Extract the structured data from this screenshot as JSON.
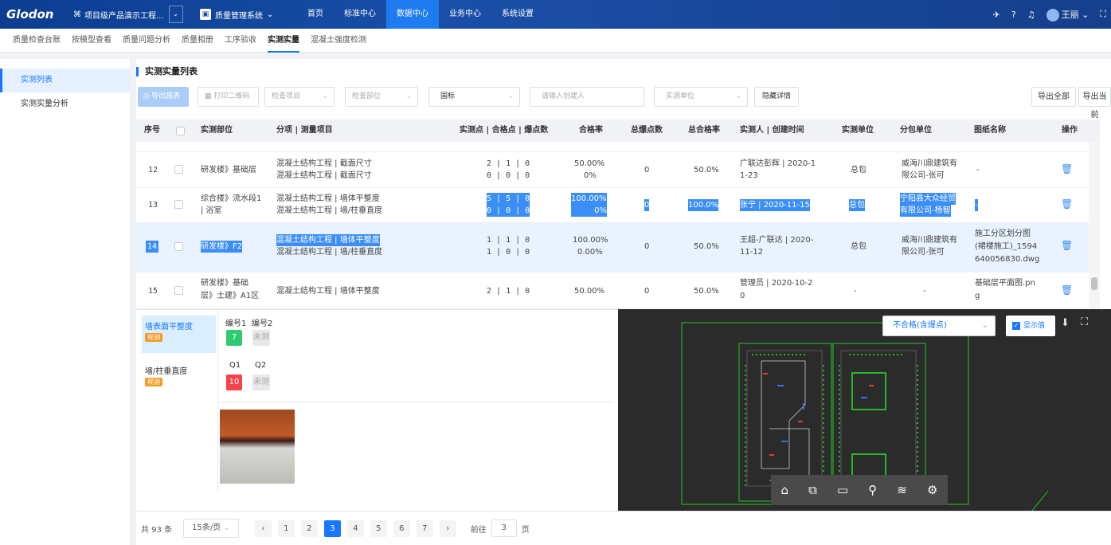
{
  "topbar": {
    "logo": "Glodon",
    "project": "项目级产品演示工程...",
    "system": "质量管理系统",
    "nav": [
      "首页",
      "标准中心",
      "数据中心",
      "业务中心",
      "系统设置"
    ],
    "active": "数据中心",
    "user": "王丽"
  },
  "subnav": [
    "质量检查台账",
    "按模型查看",
    "质量问题分析",
    "质量相册",
    "工序验收",
    "实测实量",
    "混凝土强度检测"
  ],
  "subnav_active": "实测实量",
  "leftnav": [
    "实测列表",
    "实测实量分析"
  ],
  "title": "实测实量列表",
  "toolbar": {
    "export_report": "导出报表",
    "print_qr": "打印二维码",
    "check_item": "检查项目",
    "check_part": "检查部位",
    "standard": "国标",
    "creator_placeholder": "请输入创建人",
    "unit": "实测单位",
    "hide_details": "隐藏详情",
    "export_all": "导出全部",
    "export_current": "导出当前"
  },
  "columns": [
    "序号",
    "实测部位",
    "分项 | 测量项目",
    "实测点 | 合格点 | 爆点数",
    "合格率",
    "总爆点数",
    "总合格率",
    "实测人 | 创建时间",
    "实测单位",
    "分包单位",
    "图纸名称",
    "操作"
  ],
  "rows": [
    {
      "no": "12",
      "part": "研发楼》基础层",
      "items": [
        "混凝土结构工程 | 截面尺寸",
        "混凝土结构工程 | 截面尺寸"
      ],
      "pts": [
        "2 | 1 | 0",
        "0 | 0 | 0"
      ],
      "rate": [
        "50.00%",
        "0%"
      ],
      "burst": "0",
      "total": "50.0%",
      "who": [
        "广联达彭辉 | 2020-1",
        "1-23"
      ],
      "unit": "总包",
      "sub": [
        "威海川鼎建筑有",
        "限公司-张可"
      ],
      "drawing": [
        "-"
      ]
    },
    {
      "no": "13",
      "part_lines": [
        "综合楼》流水段1",
        "| 浴室"
      ],
      "items": [
        "混凝土结构工程 | 墙体平整度",
        "混凝土结构工程 | 墙/柱垂直度"
      ],
      "pts": [
        "5 | 5 | 0",
        "0 | 0 | 0"
      ],
      "rate": [
        "100.00%",
        "0%"
      ],
      "burst": "0",
      "total": "100.0%",
      "who": [
        "张宁 | 2020-11-15"
      ],
      "unit": "总包",
      "sub": [
        "宁阳县大众经贸",
        "有限公司-杨智"
      ],
      "drawing": [
        "-"
      ]
    },
    {
      "no": "14",
      "part": "研发楼》F2",
      "items": [
        "混凝土结构工程 | 墙体平整度",
        "混凝土结构工程 | 墙/柱垂直度"
      ],
      "pts": [
        "1 | 1 | 0",
        "1 | 0 | 0"
      ],
      "rate": [
        "100.00%",
        "0.00%"
      ],
      "burst": "0",
      "total": "50.0%",
      "who": [
        "王超-广联达 | 2020-",
        "11-12"
      ],
      "unit": "总包",
      "sub": [
        "威海川鼎建筑有",
        "限公司-张可"
      ],
      "drawing": [
        "施工分区划分图",
        "(裙楼施工)_1594",
        "640056830.dwg"
      ]
    },
    {
      "no": "15",
      "part_lines": [
        "研发楼》基础",
        "层》土建》A1区"
      ],
      "items": [
        "混凝土结构工程 | 墙体平整度"
      ],
      "pts": [
        "2 | 1 | 0"
      ],
      "rate": [
        "50.00%"
      ],
      "burst": "0",
      "total": "50.0%",
      "who": [
        "管理员 | 2020-10-2",
        "0"
      ],
      "unit": "-",
      "sub": [
        "-"
      ],
      "drawing": [
        "基础层平面图.pn",
        "g"
      ]
    }
  ],
  "detail": {
    "items": [
      {
        "name": "墙表面平整度",
        "tag": "规测",
        "labels": [
          "编号1",
          "编号2"
        ],
        "values": [
          "7",
          "未测"
        ]
      },
      {
        "name": "墙/柱垂直度",
        "tag": "规测",
        "labels": [
          "Q1",
          "Q2"
        ],
        "values": [
          "10",
          "未测"
        ]
      }
    ]
  },
  "viewer": {
    "filter": "不合格(含爆点)",
    "show_values": "显示值"
  },
  "pager": {
    "total": "共 93 条",
    "page_size": "15条/页",
    "pages": [
      "1",
      "2",
      "3",
      "4",
      "5",
      "6",
      "7"
    ],
    "current": "3",
    "goto_label": "前往",
    "goto_value": "3",
    "page_suffix": "页"
  },
  "colors": {
    "accent": "#1677ff",
    "pass": "#2ecc71",
    "fail": "#f5424b",
    "tag": "#f59a23"
  }
}
